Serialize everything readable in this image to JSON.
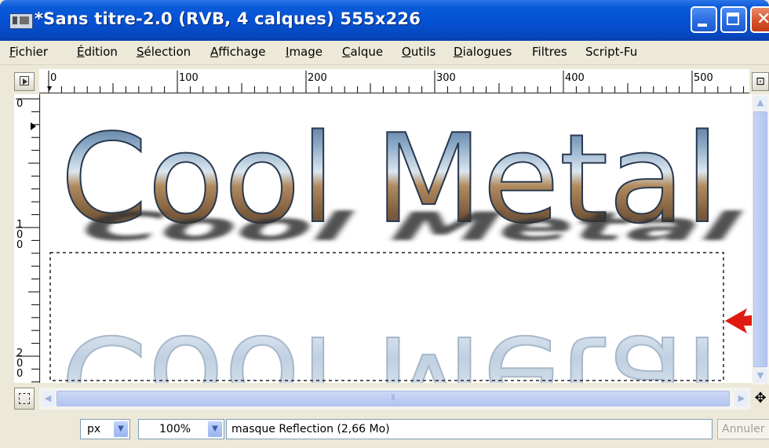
{
  "window": {
    "title": "*Sans titre-2.0 (RVB, 4 calques) 555x226"
  },
  "menu": [
    {
      "label": "Fichier",
      "u": "F",
      "rest": "ichier"
    },
    {
      "label": "Édition",
      "u": "É",
      "rest": "dition"
    },
    {
      "label": "Sélection",
      "u": "S",
      "rest": "élection"
    },
    {
      "label": "Affichage",
      "u": "A",
      "rest": "ffichage"
    },
    {
      "label": "Image",
      "u": "I",
      "rest": "mage"
    },
    {
      "label": "Calque",
      "u": "C",
      "rest": "alque"
    },
    {
      "label": "Outils",
      "u": "O",
      "rest": "utils"
    },
    {
      "label": "Dialogues",
      "u": "D",
      "rest": "ialogues"
    },
    {
      "label": "Filtres",
      "u": "",
      "rest": "Filtres"
    },
    {
      "label": "Script-Fu",
      "u": "",
      "rest": "Script-Fu"
    }
  ],
  "ruler": {
    "h_labels": [
      "0",
      "100",
      "200",
      "300",
      "400",
      "500"
    ],
    "v_labels": [
      "0",
      "100",
      "200"
    ]
  },
  "canvas": {
    "main_text": "Cool Metal",
    "shadow_text": "Cool Metal",
    "reflection_text": "Cool Metal"
  },
  "statusbar": {
    "unit": "px",
    "zoom": "100%",
    "message": "masque Reflection (2,66 Mo)",
    "cancel_label": "Annuler"
  },
  "icons": {
    "app": "gimp-image-icon",
    "navigate": "navigate-icon",
    "zoom": "zoom-icon",
    "quickmask": "quick-mask-icon",
    "move": "move-icon"
  },
  "colors": {
    "titlebar": "#0552d4",
    "arrow": "#e01a10",
    "selection": "#222222"
  }
}
